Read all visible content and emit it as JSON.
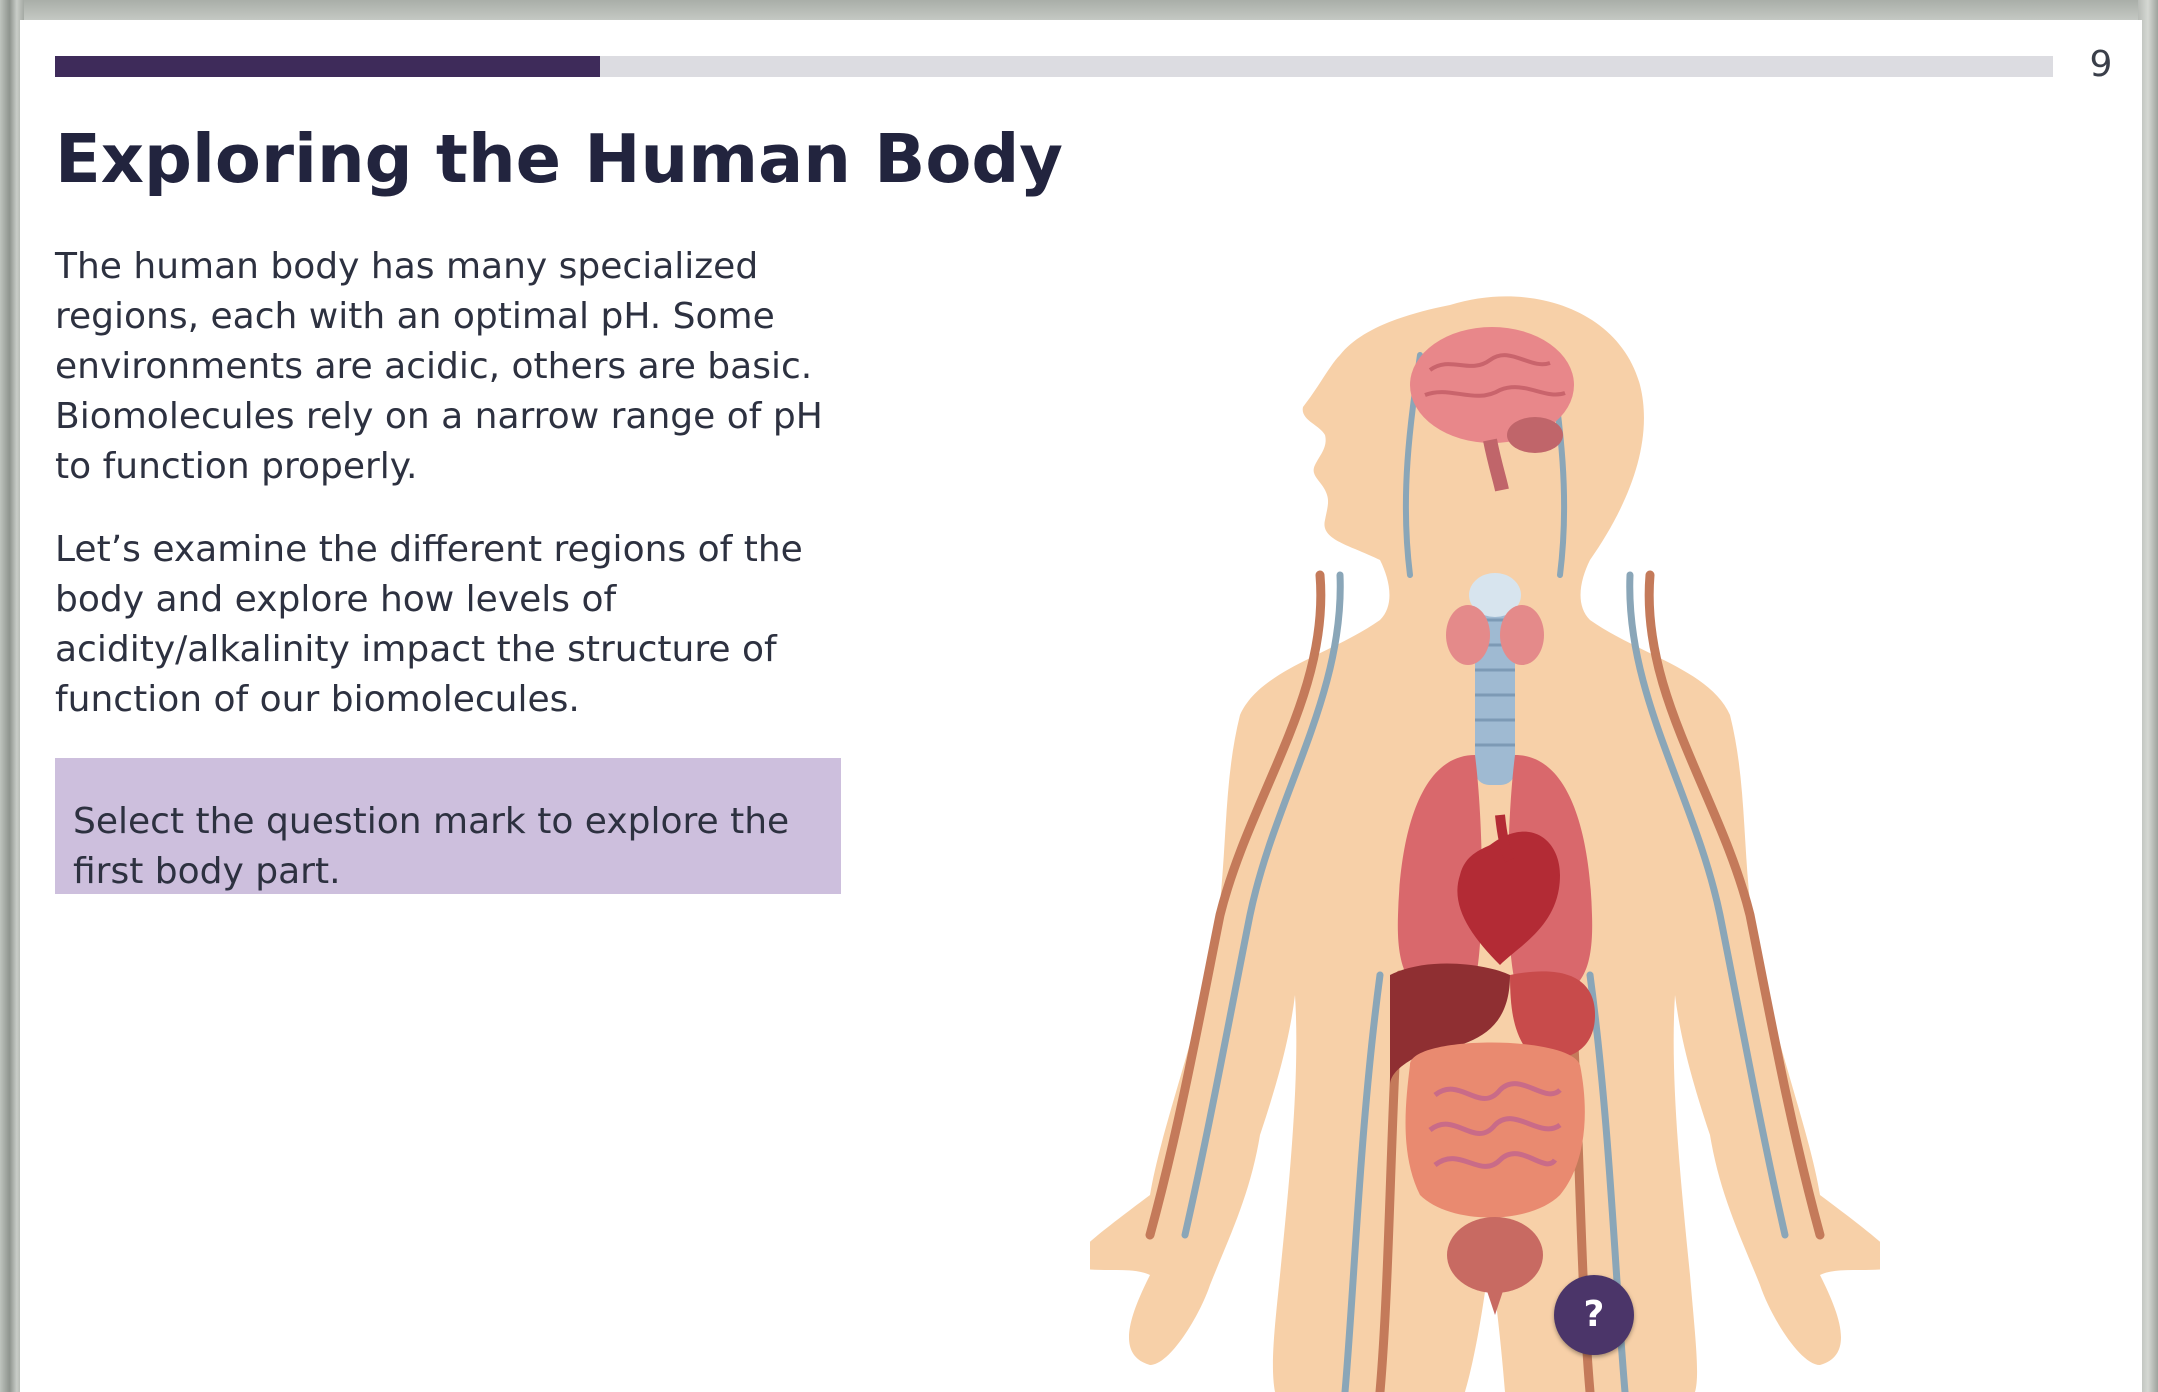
{
  "page": {
    "number": "9"
  },
  "progress": {
    "fraction": 0.273
  },
  "content": {
    "title": "Exploring the Human Body",
    "paragraph1": "The human body has many specialized regions, each with an optimal pH. Some environments are acidic, others are basic. Biomolecules rely on a narrow range of pH to function properly.",
    "paragraph2": "Let’s examine the different regions of the body and explore how levels of acidity/alkalinity impact the structure of function of our biomolecules.",
    "instruction": "Select the question mark to explore the first body part."
  },
  "hotspot": {
    "label": "?",
    "icon": "question-mark-icon"
  },
  "colors": {
    "accent": "#3e2b5a",
    "callout_bg": "#cdbfdd",
    "title": "#22243e",
    "hotspot": "#4b3569"
  }
}
